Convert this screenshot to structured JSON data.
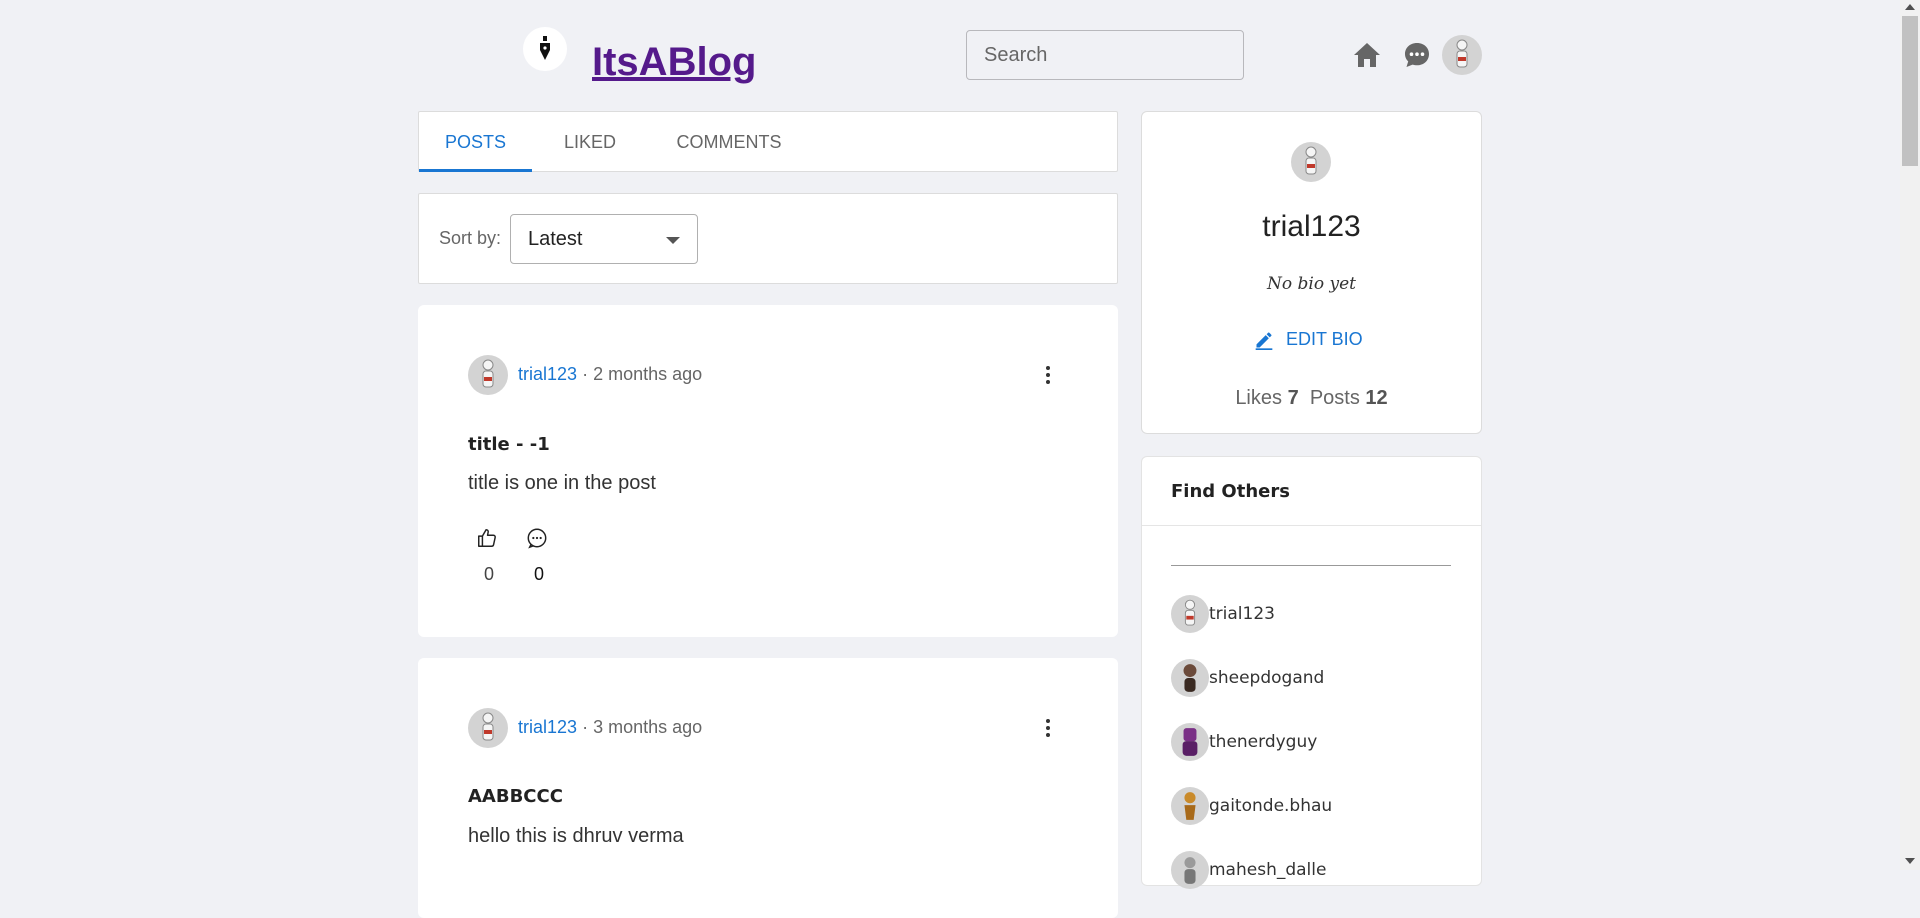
{
  "header": {
    "brand": "ItsABlog",
    "search_placeholder": "Search"
  },
  "tabs": [
    {
      "label": "POSTS",
      "active": true
    },
    {
      "label": "LIKED",
      "active": false
    },
    {
      "label": "COMMENTS",
      "active": false
    }
  ],
  "sort": {
    "label": "Sort by:",
    "value": "Latest"
  },
  "posts": [
    {
      "author": "trial123",
      "separator": "·",
      "time": "2 months ago",
      "title": "title - -1",
      "body": "title is one in the post",
      "likes": "0",
      "comments": "0"
    },
    {
      "author": "trial123",
      "separator": "·",
      "time": "3 months ago",
      "title": "AABBCCC",
      "body": "hello this is dhruv verma"
    }
  ],
  "profile": {
    "username": "trial123",
    "bio": "No bio yet",
    "edit_bio_label": "EDIT BIO",
    "likes_label": "Likes",
    "likes_count": "7",
    "posts_label": "Posts",
    "posts_count": "12"
  },
  "find_others": {
    "title": "Find Others",
    "users": [
      {
        "name": "trial123",
        "avatar_color": "#c9c9c9"
      },
      {
        "name": "sheepdogand",
        "avatar_color": "#6b4a3a"
      },
      {
        "name": "thenerdyguy",
        "avatar_color": "#7a2f86"
      },
      {
        "name": "gaitonde.bhau",
        "avatar_color": "#c98a2a"
      },
      {
        "name": "mahesh_dalle",
        "avatar_color": "#9a9a9a"
      }
    ]
  },
  "colors": {
    "accent": "#1976d2",
    "brand": "#551a8b",
    "background": "#f0f1f5"
  },
  "icons": [
    "pen-nib-icon",
    "home-icon",
    "chat-icon",
    "user-avatar",
    "more-vert-icon",
    "thumb-up-icon",
    "comment-icon",
    "edit-pencil-icon",
    "dropdown-caret-icon"
  ]
}
